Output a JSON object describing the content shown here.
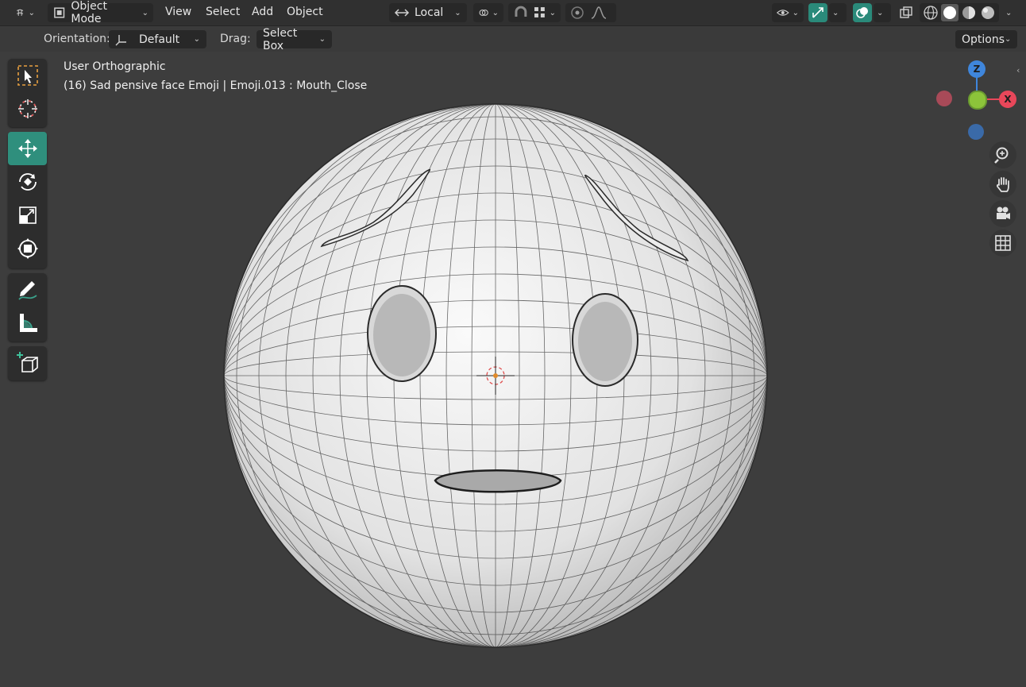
{
  "header": {
    "editor_type_icon": "3d-viewport-icon",
    "mode": "Object Mode",
    "menus": [
      "View",
      "Select",
      "Add",
      "Object"
    ],
    "transform_pivot": "Local",
    "options_label": "Options"
  },
  "subheader": {
    "orientation_label": "Orientation:",
    "orientation_value": "Default",
    "drag_label": "Drag:",
    "drag_value": "Select Box"
  },
  "viewport": {
    "view_name": "User Orthographic",
    "object_info": "(16) Sad pensive face Emoji | Emoji.013 : Mouth_Close"
  },
  "gizmo": {
    "z_label": "Z",
    "x_label": "X",
    "colors": {
      "x": "#e8475a",
      "y": "#8cc43a",
      "z": "#3f86dc"
    }
  },
  "tools": [
    "select-box",
    "cursor",
    "move",
    "rotate",
    "scale",
    "transform",
    "annotate",
    "measure",
    "add-cube"
  ],
  "accent": "#2f8f7d"
}
